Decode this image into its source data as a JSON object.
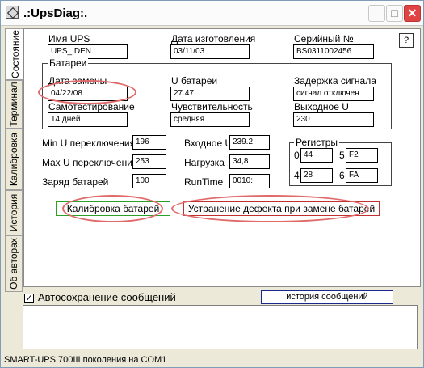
{
  "window": {
    "title": ".:UpsDiag:.",
    "min_label": "_",
    "max_label": "□",
    "close_label": "✕"
  },
  "tabs": [
    {
      "label": "Состояние"
    },
    {
      "label": "Терминал"
    },
    {
      "label": "Калибровка"
    },
    {
      "label": "История"
    },
    {
      "label": "Об авторах"
    }
  ],
  "help_label": "?",
  "info": {
    "name_label": "Имя UPS",
    "name_value": "UPS_IDEN",
    "date_label": "Дата изготовления",
    "date_value": "03/11/03",
    "serial_label": "Серийный №",
    "serial_value": "BS0311002456"
  },
  "battery": {
    "group_label": "Батареи",
    "replace_label": "Дата замены",
    "replace_value": "04/22/08",
    "voltage_label": "U батареи",
    "voltage_value": "27.47",
    "delay_label": "Задержка сигнала",
    "delay_value": "сигнал отключен",
    "selftest_label": "Самотестирование",
    "selftest_value": "14 дней",
    "sensitivity_label": "Чувствительность",
    "sensitivity_value": "средняя",
    "output_label": "Выходное U",
    "output_value": "230"
  },
  "params": {
    "min_label": "Min U переключения",
    "min_value": "196",
    "max_label": "Max U переключения",
    "max_value": "253",
    "charge_label": "Заряд батарей",
    "charge_value": "100",
    "input_label": "Входное U",
    "input_value": "239.2",
    "load_label": "Нагрузка",
    "load_value": "34,8",
    "runtime_label": "RunTime",
    "runtime_value": "0010:"
  },
  "registers": {
    "group_label": "Регистры",
    "r0_label": "0",
    "r0_value": "44",
    "r5_label": "5",
    "r5_value": "F2",
    "r4_label": "4",
    "r4_value": "28",
    "r6_label": "6",
    "r6_value": "FA"
  },
  "actions": {
    "calibrate_label": "Калибровка батарей",
    "replace_fix_label": "Устранение дефекта при замене батарей"
  },
  "autosave": {
    "checked": true,
    "label": "Автосохранение сообщений",
    "history_button": "история сообщений"
  },
  "status_bar": "SMART-UPS 700III поколения на COM1",
  "colors": {
    "calibrate_border": "#2aa02a",
    "replace_fix_border": "#c03030",
    "highlight": "#e06a6a",
    "history_border": "#1a2a8a"
  }
}
